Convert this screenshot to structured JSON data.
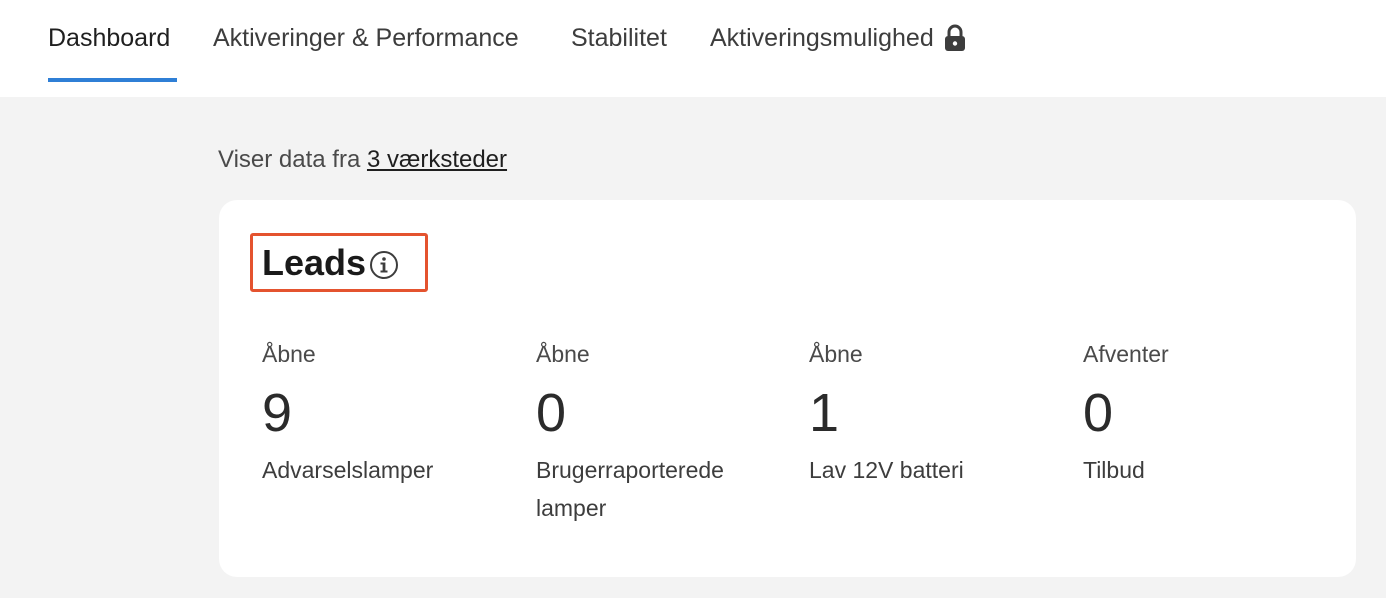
{
  "nav": {
    "tabs": [
      {
        "label": "Dashboard",
        "active": true
      },
      {
        "label": "Aktiveringer & Performance",
        "active": false
      },
      {
        "label": "Stabilitet",
        "active": false
      },
      {
        "label": "Aktiveringsmulighed",
        "active": false,
        "icon": "lock-icon"
      }
    ],
    "accent_color": "#2f7fd6"
  },
  "subtitle": {
    "prefix": "Viser data fra ",
    "link": "3 værksteder"
  },
  "leads": {
    "title": "Leads",
    "info_icon": "info-icon",
    "highlight_color": "#e4532f",
    "stats": [
      {
        "status": "Åbne",
        "value": "9",
        "label": "Advarselslamper"
      },
      {
        "status": "Åbne",
        "value": "0",
        "label": "Brugerraporterede lamper"
      },
      {
        "status": "Åbne",
        "value": "1",
        "label": "Lav 12V batteri"
      },
      {
        "status": "Afventer",
        "value": "0",
        "label": "Tilbud"
      }
    ]
  }
}
